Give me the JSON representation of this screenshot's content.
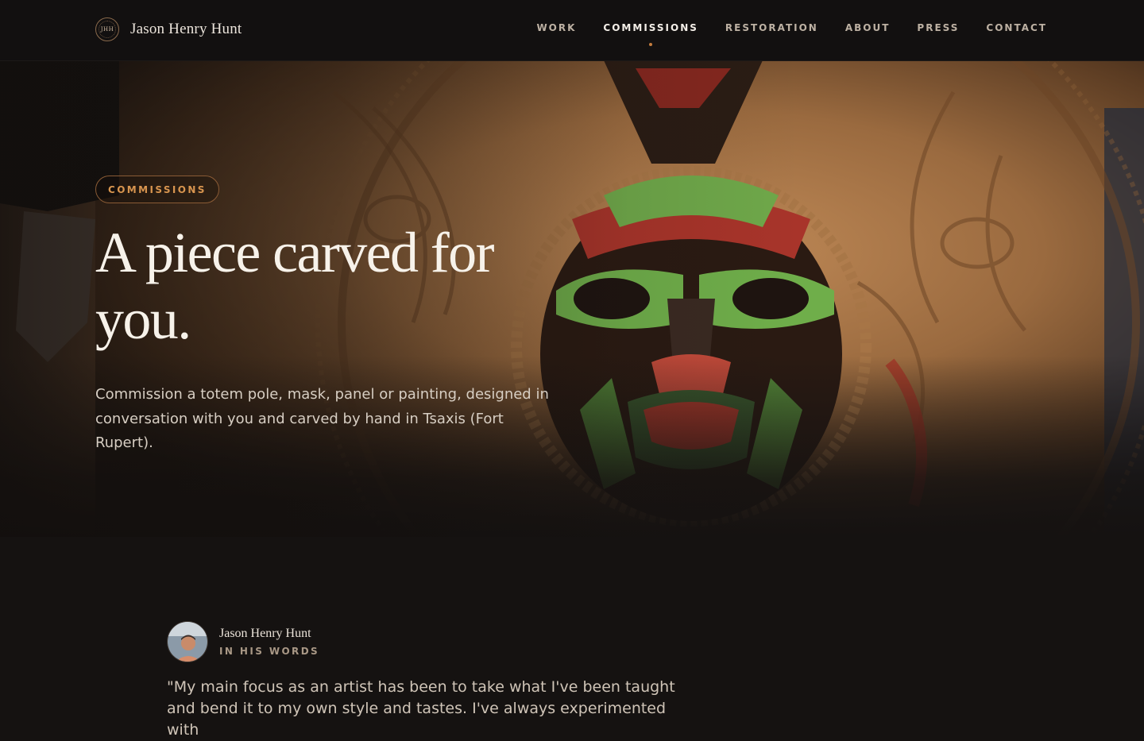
{
  "header": {
    "logo_text": "JHH",
    "brand_name": "Jason Henry Hunt",
    "nav": [
      {
        "label": "WORK",
        "active": false
      },
      {
        "label": "COMMISSIONS",
        "active": true
      },
      {
        "label": "RESTORATION",
        "active": false
      },
      {
        "label": "ABOUT",
        "active": false
      },
      {
        "label": "PRESS",
        "active": false
      },
      {
        "label": "CONTACT",
        "active": false
      }
    ]
  },
  "hero": {
    "pill": "COMMISSIONS",
    "title": "A piece carved for you.",
    "subtitle": "Commission a totem pole, mask, panel or painting, designed in conversation with you and carved by hand in Tsaxis (Fort Rupert).",
    "image": "carved-mask-photo"
  },
  "quote": {
    "author_name": "Jason Henry Hunt",
    "author_tag": "IN HIS WORDS",
    "text": "\"My main focus as an artist has been to take what I've been taught and bend it to my own style and tastes. I've always experimented with"
  },
  "colors": {
    "accent": "#c57d3e",
    "background": "#151211",
    "header": "#121010"
  }
}
